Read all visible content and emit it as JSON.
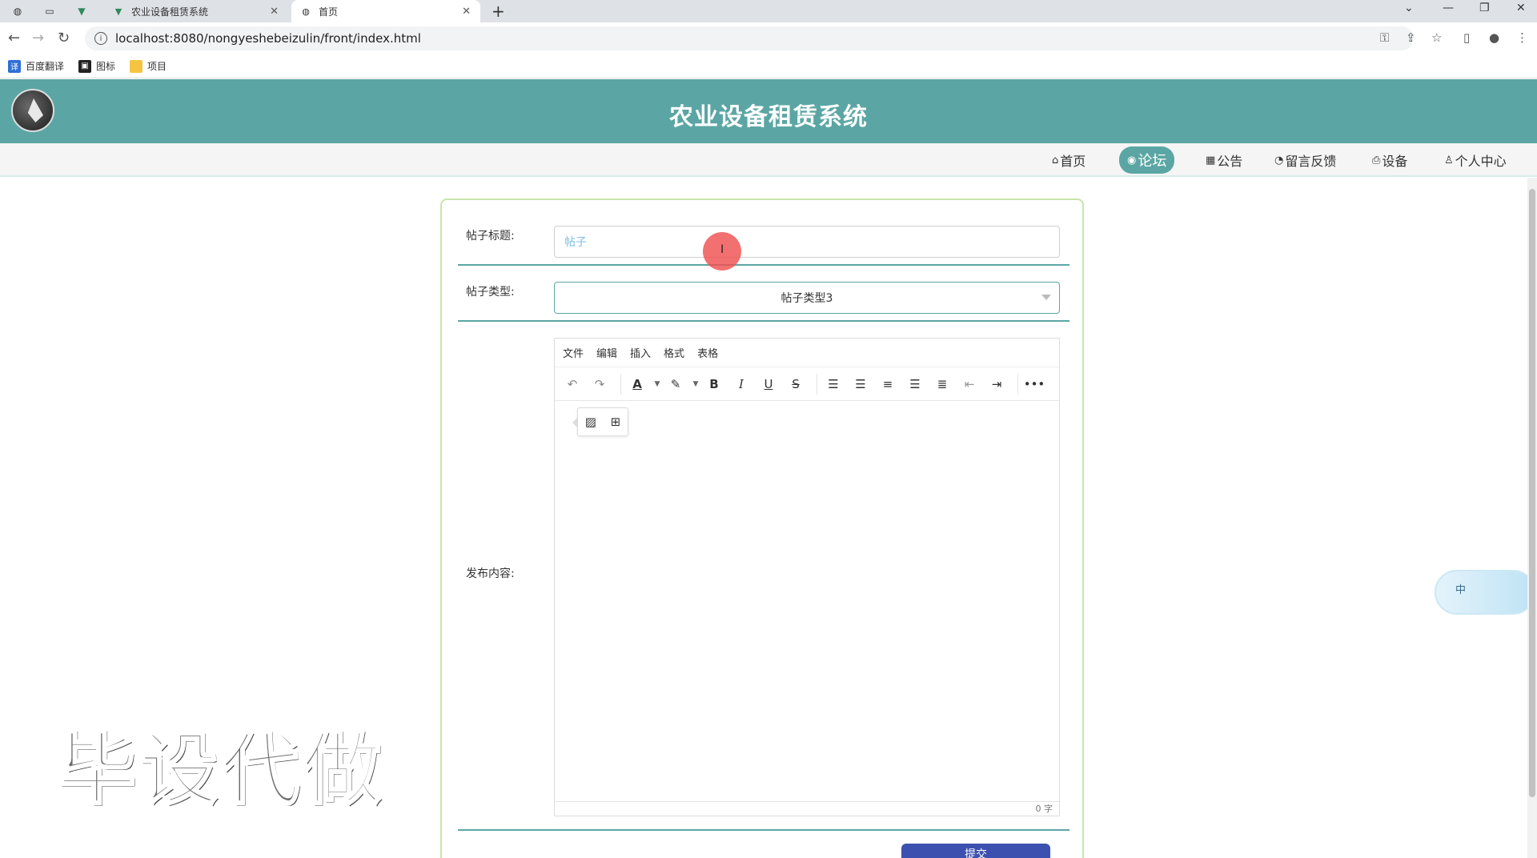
{
  "browser": {
    "tabs": [
      {
        "label": "农业设备租赁系统"
      },
      {
        "label": "首页"
      }
    ],
    "url": "localhost:8080/nongyeshebeizulin/front/index.html",
    "bookmarks": [
      "百度翻译",
      "图标",
      "项目"
    ]
  },
  "site": {
    "title": "农业设备租赁系统",
    "nav": [
      {
        "label": "首页"
      },
      {
        "label": "论坛"
      },
      {
        "label": "公告"
      },
      {
        "label": "留言反馈"
      },
      {
        "label": "设备"
      },
      {
        "label": "个人中心"
      }
    ]
  },
  "form": {
    "title_label": "帖子标题:",
    "title_value": "帖子",
    "type_label": "帖子类型:",
    "type_value": "帖子类型3",
    "content_label": "发布内容:",
    "editor_menu": [
      "文件",
      "编辑",
      "插入",
      "格式",
      "表格"
    ],
    "word_count": "0 字",
    "submit_label": "提交"
  },
  "widget": {
    "text": "中"
  },
  "watermark": "毕设代做",
  "colors": {
    "header": "#5ba6a4",
    "submit": "#3c50b0",
    "card_border": "#c7e6a8"
  }
}
